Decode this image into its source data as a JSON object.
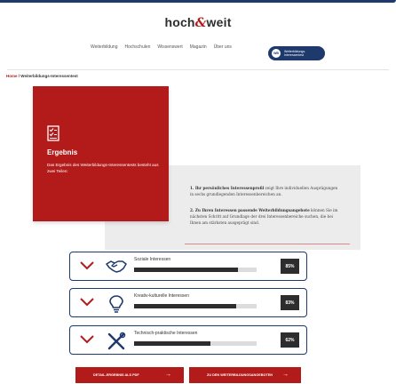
{
  "brand": {
    "part1": "hoch",
    "amp": "&",
    "part2": "weit"
  },
  "nav": {
    "items": [
      "Weiterbildung",
      "Hochschulen",
      "Wissenswert",
      "Magazin",
      "Über uns"
    ],
    "pill_badge": "WB",
    "pill_line1": "Weiterbildungs-",
    "pill_line2": "Interessentest"
  },
  "breadcrumb": {
    "home": "Home",
    "sep": " / ",
    "current": "Weiterbildungs-Interessentest"
  },
  "card": {
    "title": "Ergebnis",
    "subtitle": "Das Ergebnis des Weiterbildungs-Interessentests besteht aus zwei Teilen:"
  },
  "info": {
    "p1_bold": "1. Ihr persönliches Interessenprofil",
    "p1_rest": " zeigt Ihre individuellen Ausprägungen in sechs grundlegenden Interessenbereichen an.",
    "p2_bold": "2. Zu Ihren Interessen passende Weiterbildungsangebote",
    "p2_rest": " können Sie im nächsten Schritt auf Grundlage der drei Interessenbereiche suchen, die bei Ihnen am stärksten ausgeprägt sind."
  },
  "results": [
    {
      "label": "Soziale Interessen",
      "value": 85,
      "display": "85%",
      "icon": "handshake-icon"
    },
    {
      "label": "Kreativ-kulturelle Interessen",
      "value": 83,
      "display": "83%",
      "icon": "lightbulb-icon"
    },
    {
      "label": "Technisch-praktische Interessen",
      "value": 62,
      "display": "62%",
      "icon": "tools-icon"
    }
  ],
  "buttons": {
    "pdf": "DETAIL-ERGEBNIS ALS PDF",
    "offers": "ZU DEN WEITERBILDUNGSANGEBOTEN",
    "arrow": "→"
  },
  "colors": {
    "brand_red": "#b31b1b",
    "navy": "#1e3a6d",
    "dark": "#2d2d2d"
  }
}
